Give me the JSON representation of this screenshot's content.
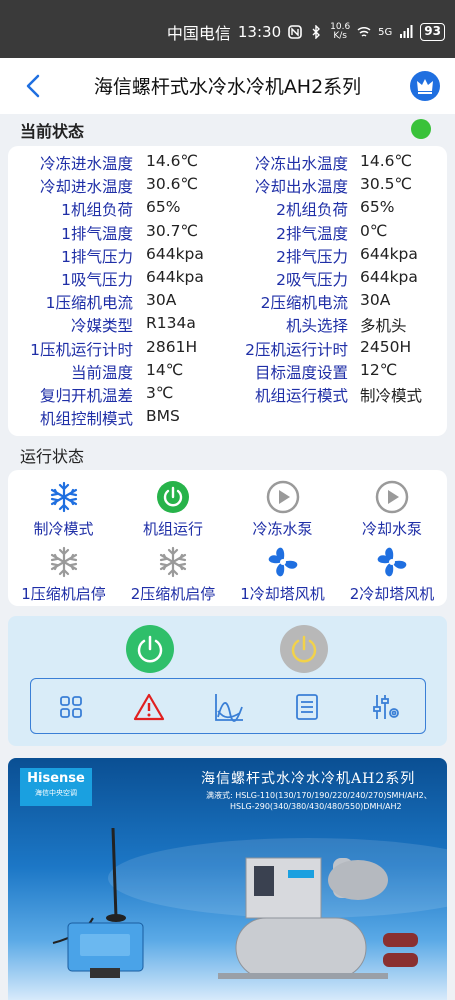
{
  "status_bar": {
    "carrier": "中国电信",
    "time": "13:30",
    "net_speed_value": "10.6",
    "net_speed_unit": "K/s",
    "signal": "5G",
    "battery": "93"
  },
  "header": {
    "title": "海信螺杆式水冷水冷机AH2系列"
  },
  "current_status": {
    "title": "当前状态",
    "indicator_color": "#39c23a",
    "rows": [
      {
        "l1": "冷冻进水温度",
        "v1": "14.6℃",
        "l2": "冷冻出水温度",
        "v2": "14.6℃"
      },
      {
        "l1": "冷却进水温度",
        "v1": "30.6℃",
        "l2": "冷却出水温度",
        "v2": "30.5℃"
      },
      {
        "l1": "1机组负荷",
        "v1": "65%",
        "l2": "2机组负荷",
        "v2": "65%"
      },
      {
        "l1": "1排气温度",
        "v1": "30.7℃",
        "l2": "2排气温度",
        "v2": "0℃"
      },
      {
        "l1": "1排气压力",
        "v1": "644kpa",
        "l2": "2排气压力",
        "v2": "644kpa"
      },
      {
        "l1": "1吸气压力",
        "v1": "644kpa",
        "l2": "2吸气压力",
        "v2": "644kpa"
      },
      {
        "l1": "1压缩机电流",
        "v1": "30A",
        "l2": "2压缩机电流",
        "v2": "30A"
      },
      {
        "l1": "冷媒类型",
        "v1": "R134a",
        "l2": "机头选择",
        "v2": "多机头"
      },
      {
        "l1": "1压机运行计时",
        "v1": "2861H",
        "l2": "2压机运行计时",
        "v2": "2450H"
      },
      {
        "l1": "当前温度",
        "v1": "14℃",
        "l2": "目标温度设置",
        "v2": "12℃"
      },
      {
        "l1": "复归开机温差",
        "v1": "3℃",
        "l2": "机组运行模式",
        "v2": "制冷模式"
      },
      {
        "l1": "机组控制模式",
        "v1": "BMS",
        "l2": "",
        "v2": ""
      }
    ]
  },
  "run_status": {
    "title": "运行状态",
    "items": [
      {
        "label": "制冷模式",
        "icon": "snowflake-icon",
        "color": "#1f6fe0"
      },
      {
        "label": "机组运行",
        "icon": "power-icon",
        "color": "#27b34a"
      },
      {
        "label": "冷冻水泵",
        "icon": "play-icon",
        "color": "#9a9a9a"
      },
      {
        "label": "冷却水泵",
        "icon": "play-icon",
        "color": "#9a9a9a"
      },
      {
        "label": "1压缩机启停",
        "icon": "snowflake-icon",
        "color": "#9a9a9a"
      },
      {
        "label": "2压缩机启停",
        "icon": "snowflake-icon",
        "color": "#9a9a9a"
      },
      {
        "label": "1冷却塔风机",
        "icon": "fan-icon",
        "color": "#1f6fe0"
      },
      {
        "label": "2冷却塔风机",
        "icon": "fan-icon",
        "color": "#1f6fe0"
      }
    ]
  },
  "control": {
    "power_on_color": "#2fbf6a",
    "power_off_color": "#b8b8b8",
    "toolbar": [
      "grid-icon",
      "warning-icon",
      "chart-icon",
      "document-icon",
      "settings-sliders-icon"
    ]
  },
  "banner": {
    "brand": "Hisense",
    "brand_sub": "海信中央空调",
    "title": "海信螺杆式水冷水冷机AH2系列",
    "sub_line1": "满液式: HSLG-110(130/170/190/220/240/270)SMH/AH2、",
    "sub_line2": "HSLG-290(340/380/430/480/550)DMH/AH2"
  }
}
